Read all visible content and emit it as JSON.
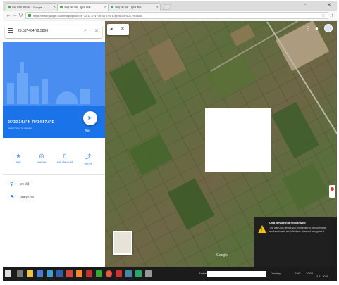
{
  "browser": {
    "tabs": [
      {
        "label": "ज्ञात फोटो सर्च करें - Google",
        "active": false
      },
      {
        "label": "जगह का पता - गूगल मैप्स",
        "active": true
      },
      {
        "label": "जगह का पता - गूगल मैप्स",
        "active": false
      }
    ],
    "url": "https://www.google.co.in/maps/place/26°32'14.6\"N+79°34'57.6\"E/@26.537404,79.5806",
    "minimize_icon": "minimize-icon",
    "close_icon": "close-icon"
  },
  "search": {
    "query": "26.537404,79.5806",
    "search_icon": "search-icon",
    "close_icon": "close-icon"
  },
  "place": {
    "title": "26°32'14.6\"N 79°34'57.6\"E",
    "subtitle": "26.537404, 79.580600",
    "directions_label": "दिशा",
    "actions": [
      {
        "icon": "bookmark-icon",
        "label": "सहेजें"
      },
      {
        "icon": "nearby-icon",
        "label": "आस-पास"
      },
      {
        "icon": "phone-icon",
        "label": "अपने फ़ोन पर भेजें"
      },
      {
        "icon": "share-icon",
        "label": "शेयर करें"
      }
    ],
    "info": [
      {
        "icon": "pin-icon",
        "text": "पता जोड़ें"
      },
      {
        "icon": "flag-icon",
        "text": "कुछ छूट गया"
      }
    ]
  },
  "map": {
    "branding": "Google",
    "layer_thumb": "Map"
  },
  "notification": {
    "title": "USB device not recognized",
    "message": "The last USB device you connected to this computer malfunctioned, and Windows does not recognize it."
  },
  "taskbar": {
    "address_label": "Address",
    "desktop_label": "Desktop",
    "time": "10:54",
    "date": "11-11-2016",
    "lang": "ENG"
  }
}
